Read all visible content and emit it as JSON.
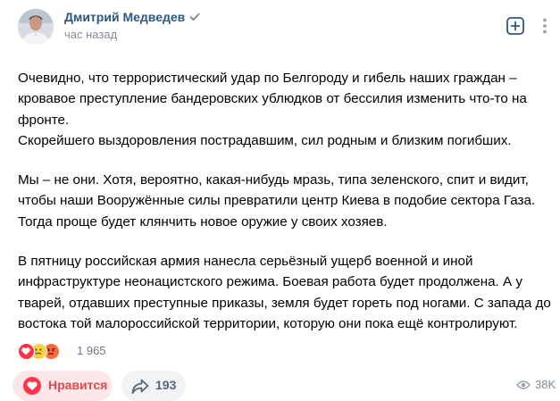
{
  "post": {
    "author": "Дмитрий Медведев",
    "time": "час назад",
    "paragraphs": [
      [
        "Очевидно, что террористический удар по Белгороду и гибель наших граждан –",
        "кровавое преступление бандеровских ублюдков от бессилия изменить что-то на",
        "фронте.",
        "Скорейшего выздоровления пострадавшим, сил родным и близким погибших."
      ],
      [
        "Мы – не они. Хотя, вероятно, какая-нибудь мразь, типа зеленского, спит и видит,",
        "чтобы наши Вооружённые силы превратили центр Киева в подобие сектора Газа.",
        "Тогда проще будет клянчить новое оружие у своих хозяев."
      ],
      [
        "В пятницу российская армия нанесла серьёзный ущерб военной и иной",
        "инфраструктуре неонацистского режима. Боевая работа будет продолжена. А у",
        "тварей, отдавших преступные приказы, земля будет гореть под ногами. С запада до",
        "востока той малороссийской территории, которую они пока ещё контролируют."
      ]
    ],
    "reactions": {
      "icons": [
        "heart-reaction-icon",
        "sad-reaction-icon",
        "angry-reaction-icon"
      ],
      "count": "1 965"
    },
    "like_label": "Нравится",
    "share_count": "193",
    "views": "38K"
  },
  "colors": {
    "author_link": "#2a5885",
    "like_red": "#e64646",
    "secondary_text": "#818c99"
  }
}
